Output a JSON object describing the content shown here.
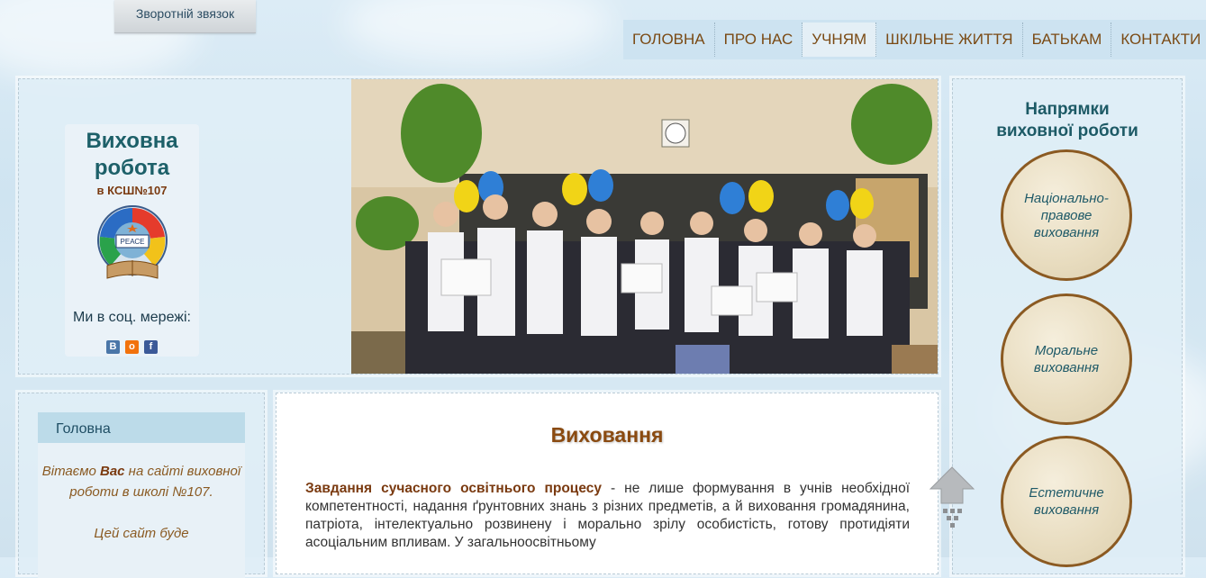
{
  "header": {
    "feedback_label": "Зворотній звязок",
    "nav": [
      "ГОЛОВНА",
      "ПРО НАС",
      "УЧНЯМ",
      "ШКІЛЬНЕ ЖИТТЯ",
      "БАТЬКАМ",
      "КОНТАКТИ"
    ],
    "active_nav": "УЧНЯМ"
  },
  "brand": {
    "title": "Виховна робота",
    "subtitle": "в КСШ№107",
    "emblem_text": "РЕАСЕ",
    "social_label": "Ми в соц. мережі:",
    "social": [
      {
        "icon": "vk-icon",
        "glyph": "В",
        "color": "#4a76a8"
      },
      {
        "icon": "odnoklassniki-icon",
        "glyph": "о",
        "color": "#f2720c"
      },
      {
        "icon": "facebook-icon",
        "glyph": "f",
        "color": "#3b5998"
      }
    ]
  },
  "sidebar": {
    "menu_label": "Головна",
    "welcome_pre": "Вітаємо ",
    "welcome_bold": "Вас",
    "welcome_post": " на сайті виховної роботи в школі №107.",
    "welcome_more": "Цей сайт буде"
  },
  "content": {
    "title": "Виховання",
    "lead_bold": "Завдання сучасного освітнього процесу",
    "text": " - не лише формування в учнів необхідної компетентності, надання ґрунтовних знань з різних предметів, а й виховання громадянина, патріота, інтелектуально розвинену  і морально зрілу особистість, готову протидіяти асоціальним впливам. У загальноосвітньому"
  },
  "right": {
    "title": "Напрямки виховної роботи",
    "items": [
      "Національно-правове виховання",
      "Моральне виховання",
      "Естетичне виховання"
    ]
  },
  "colors": {
    "accent_brown": "#8a4a10",
    "teal": "#1d6069",
    "nav_bg": "#cde3f1"
  }
}
